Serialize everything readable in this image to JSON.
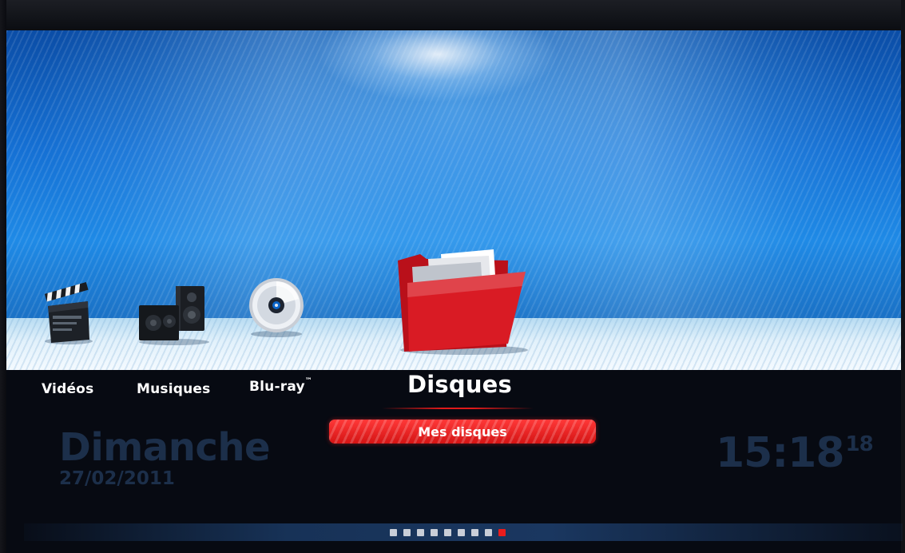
{
  "menu": {
    "items": [
      {
        "label": "Vidéos"
      },
      {
        "label": "Musiques"
      },
      {
        "label": "Blu-ray",
        "mark": "™"
      },
      {
        "label": "Disques"
      }
    ],
    "selected_index": 3,
    "submenu": {
      "label": "Mes disques"
    }
  },
  "datetime": {
    "day": "Dimanche",
    "date": "27/02/2011",
    "time": "15:18",
    "seconds": "18"
  },
  "pager": {
    "count": 9,
    "active": 9
  },
  "colors": {
    "accent_red": "#e01a1a",
    "background_blue": "#1f8ae6",
    "dim_text": "#1c2f4a"
  },
  "icons": [
    "clapperboard-icon",
    "speakers-icon",
    "disc-icon",
    "folder-icon"
  ]
}
